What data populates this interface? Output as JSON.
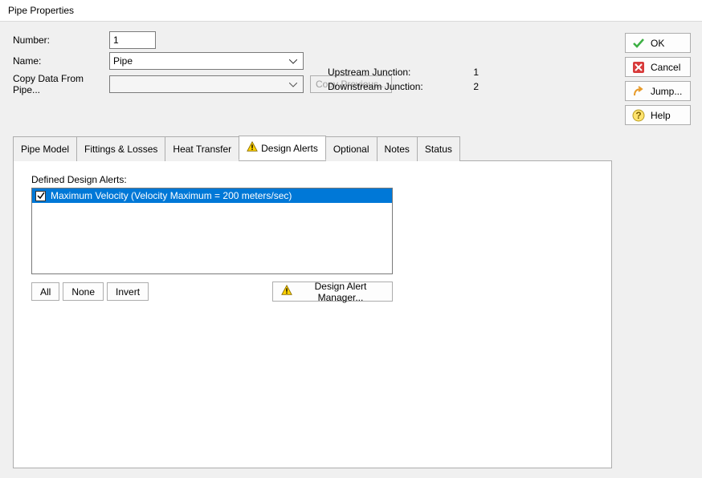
{
  "window": {
    "title": "Pipe Properties"
  },
  "form": {
    "number_label": "Number:",
    "number_value": "1",
    "name_label": "Name:",
    "name_value": "Pipe",
    "copy_label": "Copy Data From Pipe...",
    "copy_value": "",
    "copy_previous_label": "Copy Previous..."
  },
  "junctions": {
    "upstream_label": "Upstream Junction:",
    "upstream_value": "1",
    "downstream_label": "Downstream Junction:",
    "downstream_value": "2"
  },
  "buttons": {
    "ok": "OK",
    "cancel": "Cancel",
    "jump": "Jump...",
    "help": "Help"
  },
  "tabs": {
    "pipe_model": "Pipe Model",
    "fittings": "Fittings & Losses",
    "heat": "Heat Transfer",
    "design_alerts": "Design Alerts",
    "optional": "Optional",
    "notes": "Notes",
    "status": "Status"
  },
  "design_alerts": {
    "heading": "Defined Design Alerts:",
    "items": [
      {
        "checked": true,
        "label": "Maximum Velocity (Velocity Maximum = 200 meters/sec)"
      }
    ],
    "btn_all": "All",
    "btn_none": "None",
    "btn_invert": "Invert",
    "btn_manager": "Design Alert Manager..."
  }
}
